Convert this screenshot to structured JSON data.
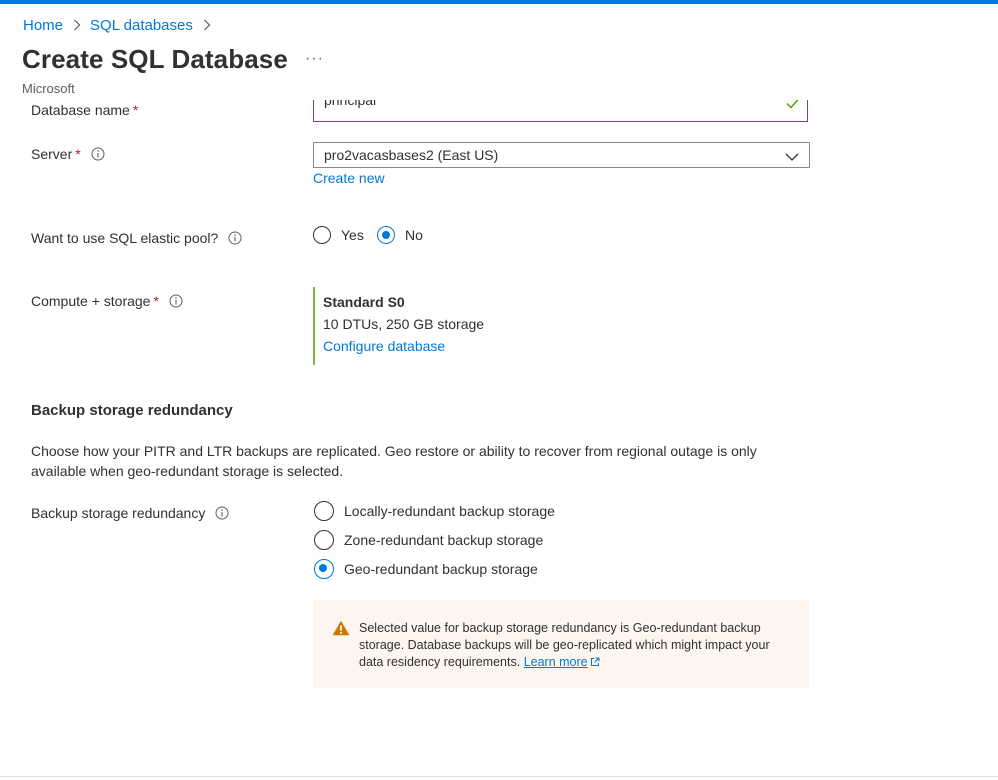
{
  "breadcrumb": {
    "items": [
      {
        "label": "Home"
      },
      {
        "label": "SQL databases"
      }
    ]
  },
  "header": {
    "title": "Create SQL Database",
    "more_label": "···",
    "subtitle": "Microsoft"
  },
  "form": {
    "database_name": {
      "label": "Database name",
      "required_mark": "*",
      "value": "principal"
    },
    "server": {
      "label": "Server",
      "required_mark": "*",
      "value": "pro2vacasbases2 (East US)",
      "create_new_link": "Create new"
    },
    "elastic_pool": {
      "label": "Want to use SQL elastic pool?",
      "options": [
        {
          "label": "Yes",
          "selected": false
        },
        {
          "label": "No",
          "selected": true
        }
      ]
    },
    "compute_storage": {
      "label": "Compute + storage",
      "required_mark": "*",
      "tier": "Standard S0",
      "details": "10 DTUs, 250 GB storage",
      "configure_link": "Configure database"
    }
  },
  "backup": {
    "section_title": "Backup storage redundancy",
    "description": "Choose how your PITR and LTR backups are replicated. Geo restore or ability to recover from regional outage is only available when geo-redundant storage is selected.",
    "field_label": "Backup storage redundancy",
    "options": [
      {
        "label": "Locally-redundant backup storage",
        "selected": false
      },
      {
        "label": "Zone-redundant backup storage",
        "selected": false
      },
      {
        "label": "Geo-redundant backup storage",
        "selected": true
      }
    ],
    "warning": {
      "text": "Selected value for backup storage redundancy is Geo-redundant backup storage. Database backups will be geo-replicated which might impact your data residency requirements.",
      "link": "Learn more"
    }
  },
  "colors": {
    "accent": "#0078d4",
    "required": "#a4262c",
    "success": "#7dbb33",
    "warning_icon": "#d47500",
    "warning_bg": "#fdf6f0"
  }
}
